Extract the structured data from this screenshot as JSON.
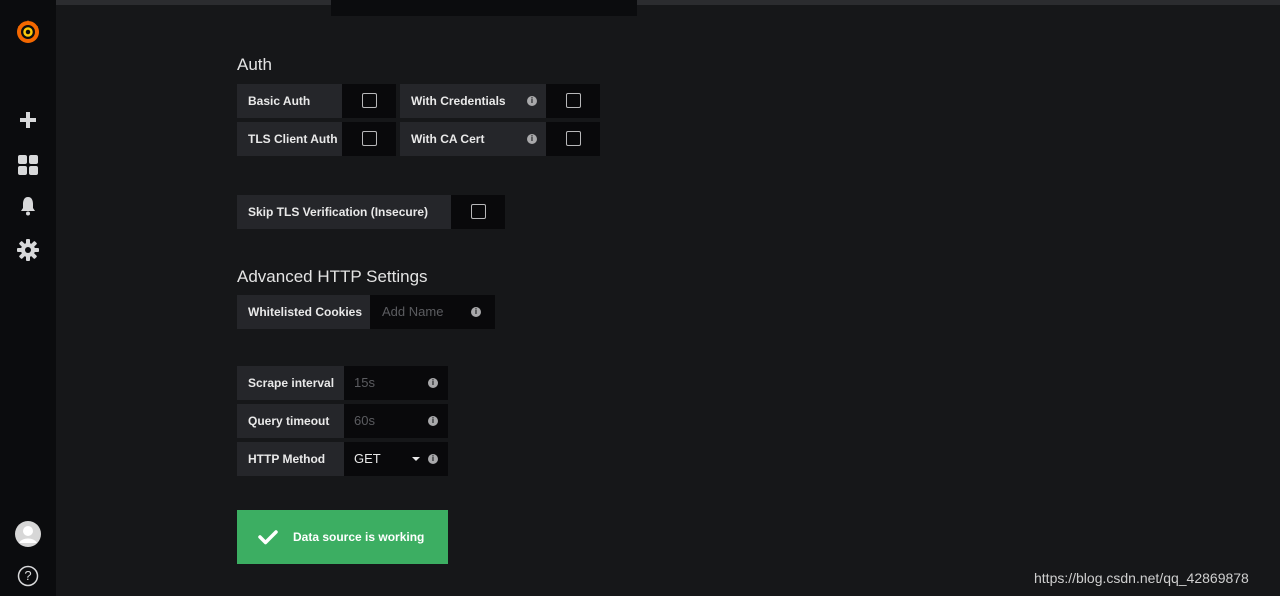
{
  "sidebar": {
    "icons": [
      "grafana-logo",
      "plus-icon",
      "dashboards-icon",
      "bell-icon",
      "gear-icon",
      "avatar",
      "help-icon"
    ],
    "help_glyph": "?"
  },
  "auth": {
    "title": "Auth",
    "basic_auth": "Basic Auth",
    "with_credentials": "With Credentials",
    "tls_client_auth": "TLS Client Auth",
    "with_ca_cert": "With CA Cert",
    "skip_tls": "Skip TLS Verification (Insecure)"
  },
  "advanced": {
    "title": "Advanced HTTP Settings",
    "whitelisted_cookies": "Whitelisted Cookies",
    "cookies_placeholder": "Add Name"
  },
  "prometheus": {
    "scrape_interval_label": "Scrape interval",
    "scrape_interval_placeholder": "15s",
    "query_timeout_label": "Query timeout",
    "query_timeout_placeholder": "60s",
    "http_method_label": "HTTP Method",
    "http_method_value": "GET"
  },
  "status": {
    "message": "Data source is working",
    "color": "#3cae62"
  },
  "info_glyph": "i",
  "watermark": "https://blog.csdn.net/qq_42869878"
}
